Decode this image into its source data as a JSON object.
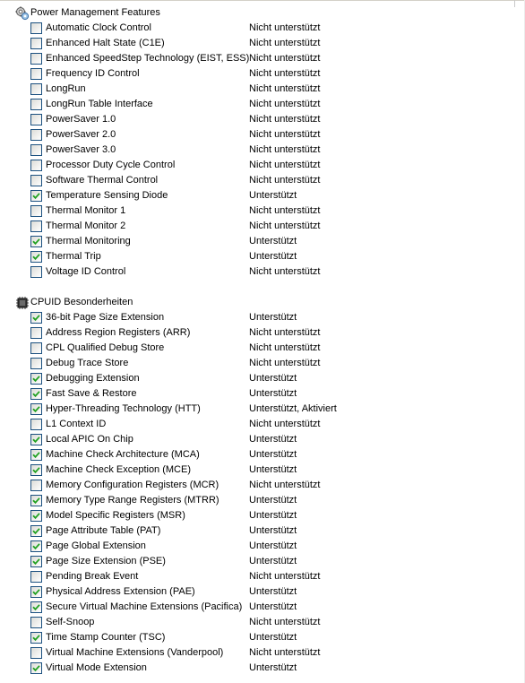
{
  "sections": [
    {
      "title": "Power Management Features",
      "icon": "power-management-icon",
      "items": [
        {
          "name": "Automatic Clock Control",
          "status": "Nicht unterstützt",
          "checked": false
        },
        {
          "name": "Enhanced Halt State (C1E)",
          "status": "Nicht unterstützt",
          "checked": false
        },
        {
          "name": "Enhanced SpeedStep Technology (EIST, ESS)",
          "status": "Nicht unterstützt",
          "checked": false
        },
        {
          "name": "Frequency ID Control",
          "status": "Nicht unterstützt",
          "checked": false
        },
        {
          "name": "LongRun",
          "status": "Nicht unterstützt",
          "checked": false
        },
        {
          "name": "LongRun Table Interface",
          "status": "Nicht unterstützt",
          "checked": false
        },
        {
          "name": "PowerSaver 1.0",
          "status": "Nicht unterstützt",
          "checked": false
        },
        {
          "name": "PowerSaver 2.0",
          "status": "Nicht unterstützt",
          "checked": false
        },
        {
          "name": "PowerSaver 3.0",
          "status": "Nicht unterstützt",
          "checked": false
        },
        {
          "name": "Processor Duty Cycle Control",
          "status": "Nicht unterstützt",
          "checked": false
        },
        {
          "name": "Software Thermal Control",
          "status": "Nicht unterstützt",
          "checked": false
        },
        {
          "name": "Temperature Sensing Diode",
          "status": "Unterstützt",
          "checked": true
        },
        {
          "name": "Thermal Monitor 1",
          "status": "Nicht unterstützt",
          "checked": false
        },
        {
          "name": "Thermal Monitor 2",
          "status": "Nicht unterstützt",
          "checked": false
        },
        {
          "name": "Thermal Monitoring",
          "status": "Unterstützt",
          "checked": true
        },
        {
          "name": "Thermal Trip",
          "status": "Unterstützt",
          "checked": true
        },
        {
          "name": "Voltage ID Control",
          "status": "Nicht unterstützt",
          "checked": false
        }
      ]
    },
    {
      "title": "CPUID Besonderheiten",
      "icon": "cpu-chip-icon",
      "items": [
        {
          "name": "36-bit Page Size Extension",
          "status": "Unterstützt",
          "checked": true
        },
        {
          "name": "Address Region Registers (ARR)",
          "status": "Nicht unterstützt",
          "checked": false
        },
        {
          "name": "CPL Qualified Debug Store",
          "status": "Nicht unterstützt",
          "checked": false
        },
        {
          "name": "Debug Trace Store",
          "status": "Nicht unterstützt",
          "checked": false
        },
        {
          "name": "Debugging Extension",
          "status": "Unterstützt",
          "checked": true
        },
        {
          "name": "Fast Save & Restore",
          "status": "Unterstützt",
          "checked": true
        },
        {
          "name": "Hyper-Threading Technology (HTT)",
          "status": "Unterstützt, Aktiviert",
          "checked": true
        },
        {
          "name": "L1 Context ID",
          "status": "Nicht unterstützt",
          "checked": false
        },
        {
          "name": "Local APIC On Chip",
          "status": "Unterstützt",
          "checked": true
        },
        {
          "name": "Machine Check Architecture (MCA)",
          "status": "Unterstützt",
          "checked": true
        },
        {
          "name": "Machine Check Exception (MCE)",
          "status": "Unterstützt",
          "checked": true
        },
        {
          "name": "Memory Configuration Registers (MCR)",
          "status": "Nicht unterstützt",
          "checked": false
        },
        {
          "name": "Memory Type Range Registers (MTRR)",
          "status": "Unterstützt",
          "checked": true
        },
        {
          "name": "Model Specific Registers (MSR)",
          "status": "Unterstützt",
          "checked": true
        },
        {
          "name": "Page Attribute Table (PAT)",
          "status": "Unterstützt",
          "checked": true
        },
        {
          "name": "Page Global Extension",
          "status": "Unterstützt",
          "checked": true
        },
        {
          "name": "Page Size Extension (PSE)",
          "status": "Unterstützt",
          "checked": true
        },
        {
          "name": "Pending Break Event",
          "status": "Nicht unterstützt",
          "checked": false
        },
        {
          "name": "Physical Address Extension (PAE)",
          "status": "Unterstützt",
          "checked": true
        },
        {
          "name": "Secure Virtual Machine Extensions (Pacifica)",
          "status": "Unterstützt",
          "checked": true
        },
        {
          "name": "Self-Snoop",
          "status": "Nicht unterstützt",
          "checked": false
        },
        {
          "name": "Time Stamp Counter (TSC)",
          "status": "Unterstützt",
          "checked": true
        },
        {
          "name": "Virtual Machine Extensions (Vanderpool)",
          "status": "Nicht unterstützt",
          "checked": false
        },
        {
          "name": "Virtual Mode Extension",
          "status": "Unterstützt",
          "checked": true
        }
      ]
    }
  ],
  "colors": {
    "checkbox_border": "#1c5180",
    "checkmark": "#21a121",
    "text": "#000000"
  }
}
